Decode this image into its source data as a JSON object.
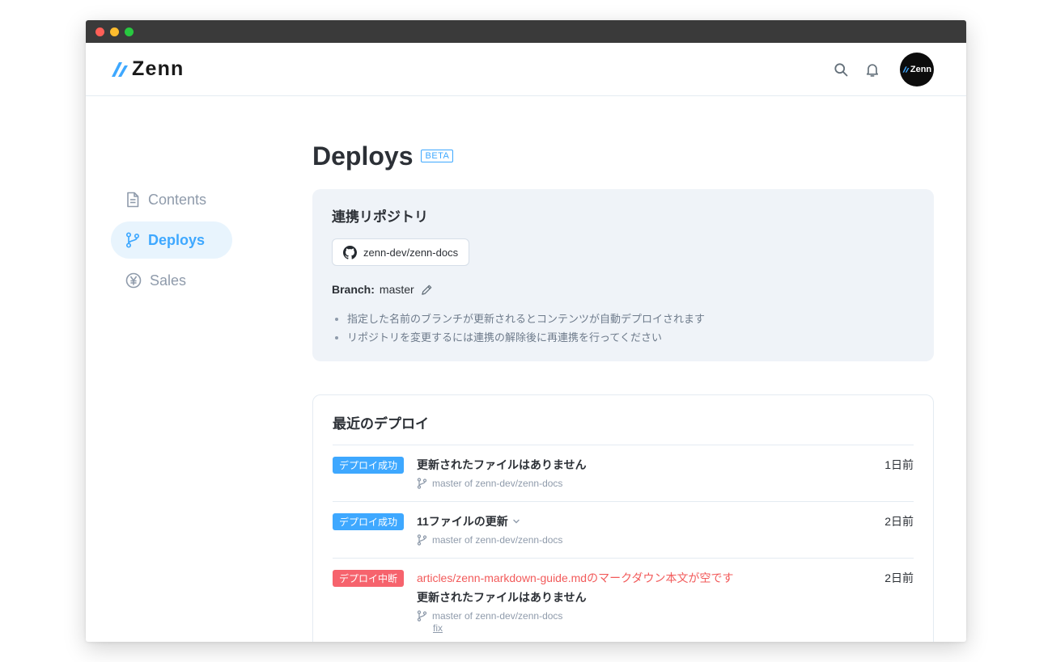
{
  "colors": {
    "accent": "#3ea8ff",
    "success": "#3ea8ff",
    "danger": "#f6636d",
    "dot_close": "#ff5f57",
    "dot_min": "#febc2e",
    "dot_max": "#28c840"
  },
  "header": {
    "logo_text": "Zenn",
    "search_icon": "search-icon",
    "notification_icon": "bell-icon",
    "avatar_text": "Zenn"
  },
  "sidebar": {
    "items": [
      {
        "label": "Contents",
        "icon": "document-icon",
        "active": false
      },
      {
        "label": "Deploys",
        "icon": "branch-icon",
        "active": true
      },
      {
        "label": "Sales",
        "icon": "yen-icon",
        "active": false
      }
    ]
  },
  "main": {
    "title": "Deploys",
    "badge": "BETA",
    "repo": {
      "title": "連携リポジトリ",
      "repo_name": "zenn-dev/zenn-docs",
      "branch_label": "Branch:",
      "branch_value": "master",
      "notes": [
        "指定した名前のブランチが更新されるとコンテンツが自動デプロイされます",
        "リポジトリを変更するには連携の解除後に再連携を行ってください"
      ]
    },
    "deploys": {
      "title": "最近のデプロイ",
      "rows": [
        {
          "status": "デプロイ成功",
          "title": "更新されたファイルはありません",
          "meta": "master of zenn-dev/zenn-docs",
          "time": "1日前"
        },
        {
          "status": "デプロイ成功",
          "title": "11ファイルの更新",
          "meta": "master of zenn-dev/zenn-docs",
          "time": "2日前"
        },
        {
          "status": "デプロイ中断",
          "error": "articles/zenn-markdown-guide.mdのマークダウン本文が空です",
          "title": "更新されたファイルはありません",
          "meta": "master of zenn-dev/zenn-docs",
          "commit": "fix",
          "time": "2日前"
        }
      ]
    }
  }
}
